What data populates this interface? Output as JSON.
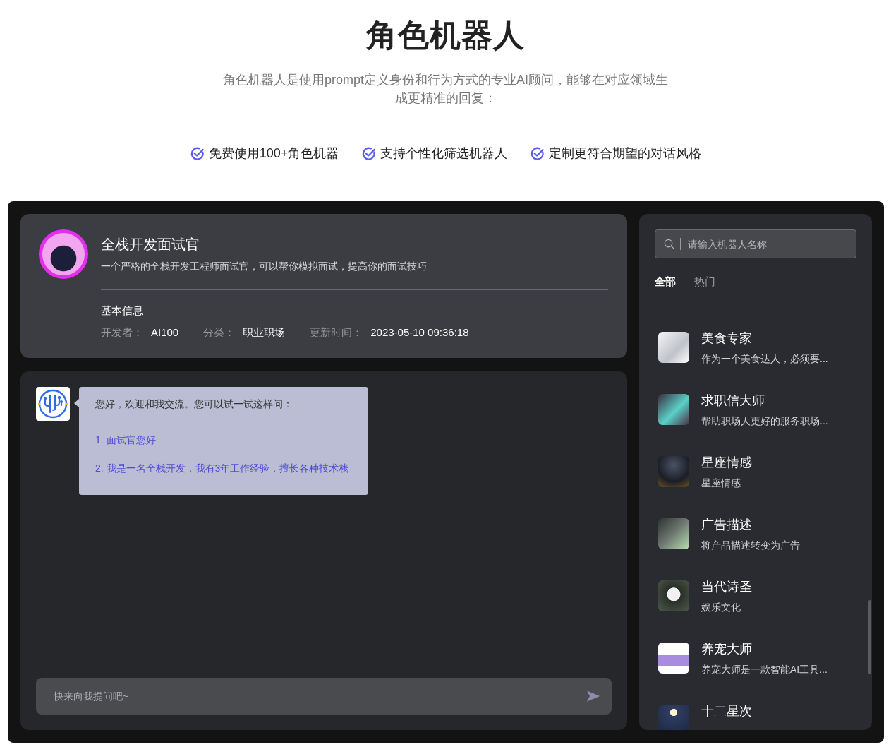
{
  "header": {
    "title": "角色机器人",
    "subtitle": "角色机器人是使用prompt定义身份和行为方式的专业AI顾问，能够在对应领域生成更精准的回复：",
    "features": [
      "免费使用100+角色机器",
      "支持个性化筛选机器人",
      "定制更符合期望的对话风格"
    ]
  },
  "bot_profile": {
    "name": "全栈开发面试官",
    "description": "一个严格的全栈开发工程师面试官，可以帮你模拟面试，提高你的面试技巧",
    "info_title": "基本信息",
    "fields": [
      {
        "label": "开发者：",
        "value": "AI100"
      },
      {
        "label": "分类：",
        "value": "职业职场"
      },
      {
        "label": "更新时间：",
        "value": "2023-05-10 09:36:18"
      }
    ]
  },
  "chat": {
    "messages": [
      {
        "text": "您好，欢迎和我交流。您可以试一试这样问：",
        "suggestions": [
          "1. 面试官您好",
          "2. 我是一名全栈开发，我有3年工作经验，擅长各种技术栈"
        ]
      }
    ],
    "input": {
      "placeholder": "快来向我提问吧~"
    }
  },
  "sidebar": {
    "search": {
      "placeholder": "请输入机器人名称"
    },
    "tabs": [
      {
        "label": "全部",
        "selected": true
      },
      {
        "label": "热门",
        "selected": false
      }
    ],
    "bots": [
      {
        "name": "美食专家",
        "description": "作为一个美食达人，必须要..."
      },
      {
        "name": "求职信大师",
        "description": "帮助职场人更好的服务职场..."
      },
      {
        "name": "星座情感",
        "description": "星座情感"
      },
      {
        "name": "广告描述",
        "description": "将产品描述转变为广告"
      },
      {
        "name": "当代诗圣",
        "description": "娱乐文化"
      },
      {
        "name": "养宠大师",
        "description": "养宠大师是一款智能AI工具..."
      },
      {
        "name": "十二星次"
      }
    ]
  }
}
